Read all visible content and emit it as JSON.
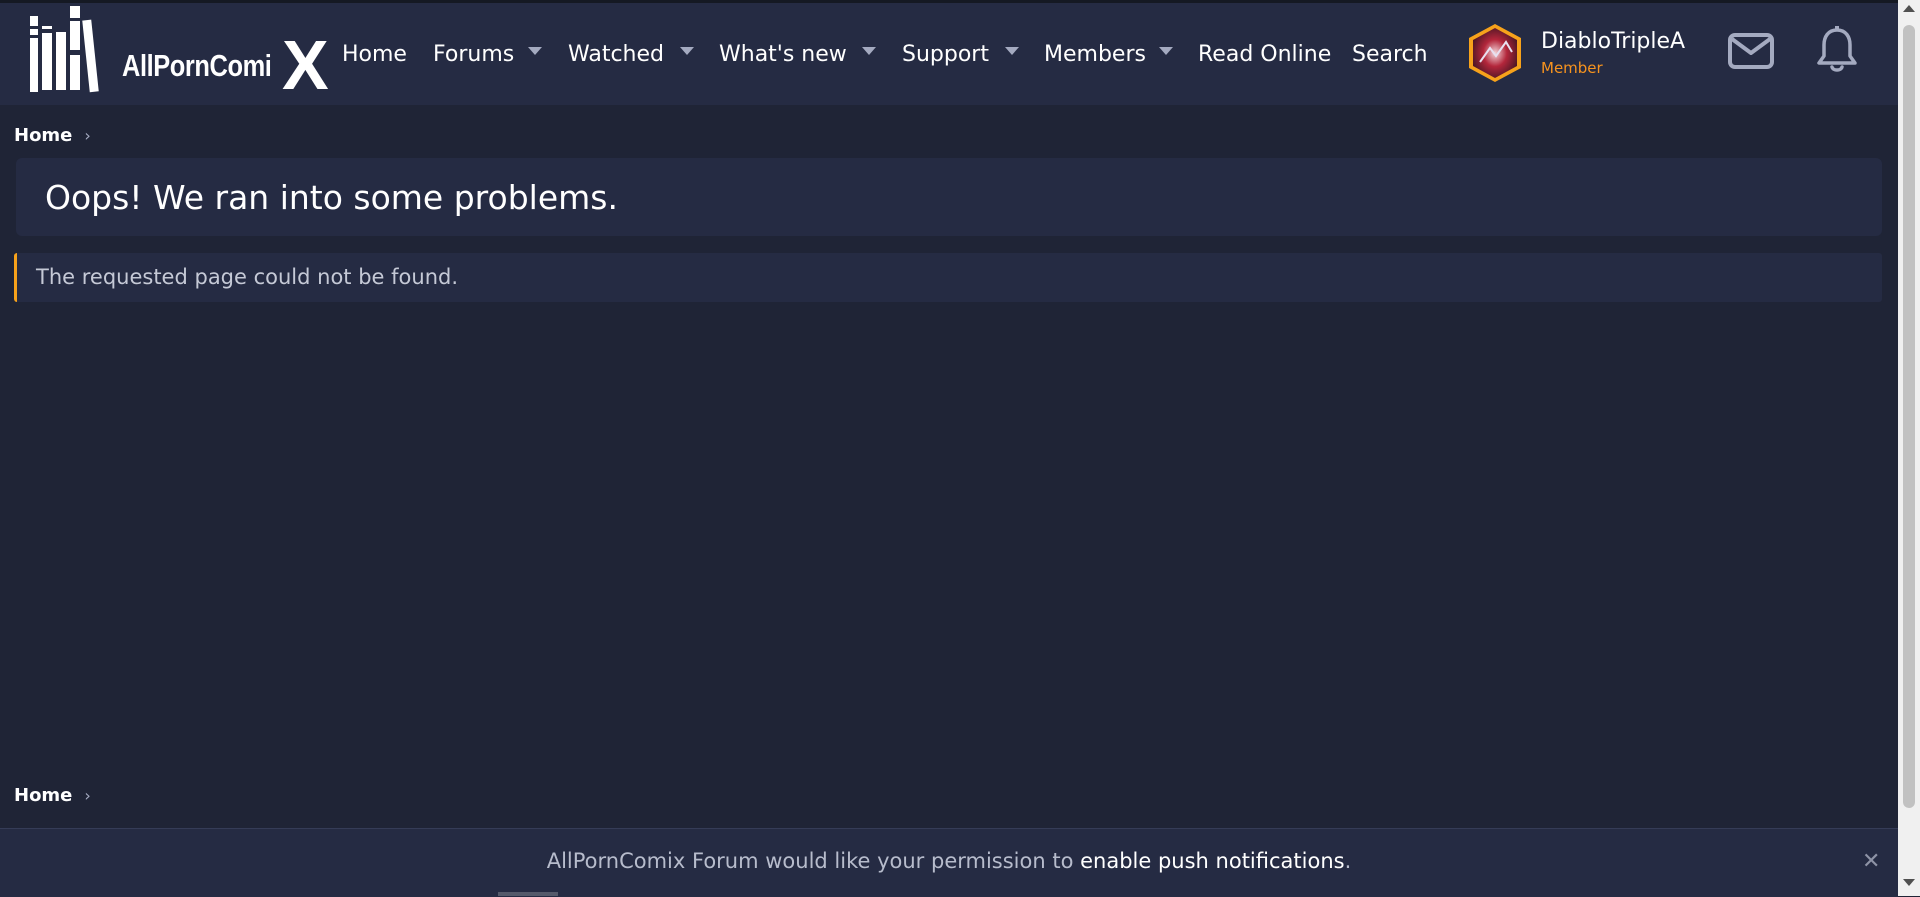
{
  "brand": {
    "logo_text": "AllPornComi",
    "logo_x": "X",
    "accent_color": "#f7931e",
    "background_color": "#1f2436",
    "panel_color": "#252b43"
  },
  "nav": {
    "items": [
      {
        "label": "Home",
        "has_dropdown": false
      },
      {
        "label": "Forums",
        "has_dropdown": true
      },
      {
        "label": "Watched",
        "has_dropdown": true
      },
      {
        "label": "What's new",
        "has_dropdown": true
      },
      {
        "label": "Support",
        "has_dropdown": true
      },
      {
        "label": "Members",
        "has_dropdown": true
      },
      {
        "label": "Read Online",
        "has_dropdown": false
      },
      {
        "label": "Search",
        "has_dropdown": false
      }
    ]
  },
  "user": {
    "name": "DiabloTripleA",
    "role": "Member"
  },
  "icons": {
    "mail": "envelope-icon",
    "notifications": "bell-icon",
    "breadcrumb_sep": "chevron-right-icon",
    "close": "close-icon"
  },
  "breadcrumb_top": {
    "label": "Home",
    "sep": "›"
  },
  "breadcrumb_bottom": {
    "label": "Home",
    "sep": "›"
  },
  "main": {
    "title": "Oops! We ran into some problems.",
    "message": "The requested page could not be found."
  },
  "push": {
    "text_before": "AllPornComix Forum would like your permission to ",
    "link_text": "enable push notifications",
    "text_after": ".",
    "close": "✕"
  }
}
